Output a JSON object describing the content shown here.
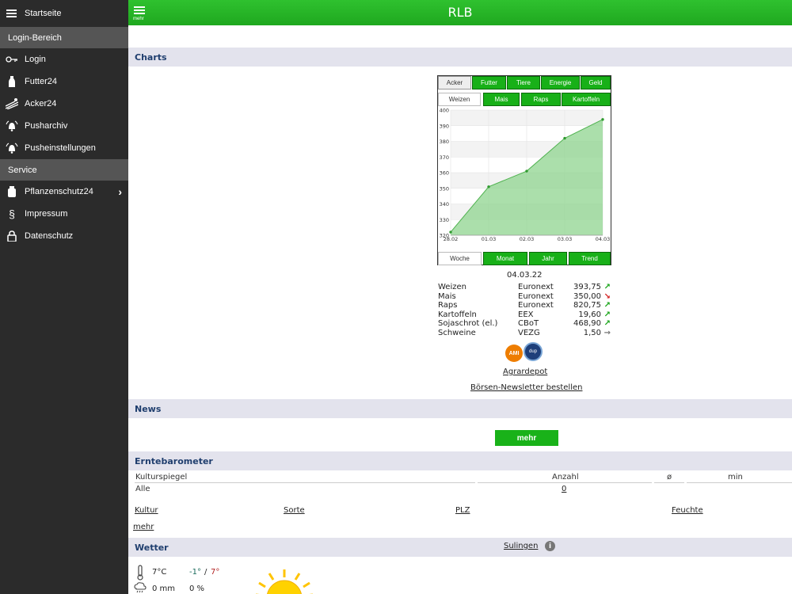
{
  "sidebar": {
    "items": [
      {
        "label": "Startseite",
        "icon": "menu-icon"
      },
      {
        "label": "Login-Bereich",
        "type": "section"
      },
      {
        "label": "Login",
        "icon": "key-icon"
      },
      {
        "label": "Futter24",
        "icon": "bottle-icon"
      },
      {
        "label": "Acker24",
        "icon": "field-icon"
      },
      {
        "label": "Pusharchiv",
        "icon": "bell-icon"
      },
      {
        "label": "Pusheinstellungen",
        "icon": "bell-settings-icon"
      },
      {
        "label": "Service",
        "type": "section"
      },
      {
        "label": "Pflanzenschutz24",
        "icon": "canister-icon"
      },
      {
        "label": "Impressum",
        "icon": "paragraph-icon"
      },
      {
        "label": "Datenschutz",
        "icon": "lock-icon"
      }
    ]
  },
  "topbar": {
    "title": "RLB",
    "menu_label": "mehr"
  },
  "charts": {
    "heading": "Charts",
    "category_tabs": [
      "Acker",
      "Futter",
      "Tiere",
      "Energie",
      "Geld"
    ],
    "product_tabs": [
      "Weizen",
      "Mais",
      "Raps",
      "Kartoffeln"
    ],
    "period_tabs": [
      "Woche",
      "Monat",
      "Jahr",
      "Trend"
    ],
    "selected_category": "Acker",
    "selected_product": "Weizen",
    "selected_period": "Woche"
  },
  "chart_data": {
    "type": "area",
    "x": [
      "28.02",
      "01.03",
      "02.03",
      "03.03",
      "04.03"
    ],
    "values": [
      322,
      351,
      361,
      382,
      394
    ],
    "ylim": [
      320,
      400
    ],
    "yticks": [
      320,
      330,
      340,
      350,
      360,
      370,
      380,
      390,
      400
    ],
    "grid": true,
    "color": "#8fd48f"
  },
  "quotes": {
    "date": "04.03.22",
    "rows": [
      {
        "name": "Weizen",
        "exchange": "Euronext",
        "value": "393,75",
        "trend": "up"
      },
      {
        "name": "Mais",
        "exchange": "Euronext",
        "value": "350,00",
        "trend": "down"
      },
      {
        "name": "Raps",
        "exchange": "Euronext",
        "value": "820,75",
        "trend": "up"
      },
      {
        "name": "Kartoffeln",
        "exchange": "EEX",
        "value": "19,60",
        "trend": "up"
      },
      {
        "name": "Sojaschrot (el.)",
        "exchange": "CBoT",
        "value": "468,90",
        "trend": "up"
      },
      {
        "name": "Schweine",
        "exchange": "VEZG",
        "value": "1,50",
        "trend": "flat"
      }
    ],
    "logo_ami": "AMI",
    "logo_2": "dup",
    "link_agrardepot": "Agrardepot",
    "link_newsletter": "Börsen-Newsletter bestellen"
  },
  "news": {
    "heading": "News",
    "button": "mehr"
  },
  "erntebarometer": {
    "heading": "Erntebarometer",
    "columns": [
      "Kulturspiegel",
      "Anzahl",
      "ø",
      "min"
    ],
    "row": {
      "label": "Alle",
      "count": "0"
    },
    "filters": [
      "Kultur",
      "Sorte",
      "PLZ",
      "Feuchte"
    ],
    "more": "mehr"
  },
  "weather": {
    "heading": "Wetter",
    "location": "Sulingen",
    "temp": "7°C",
    "min": "-1°",
    "sep": "/",
    "max": "7°",
    "rain": "0 mm",
    "rain_prob": "0 %"
  }
}
